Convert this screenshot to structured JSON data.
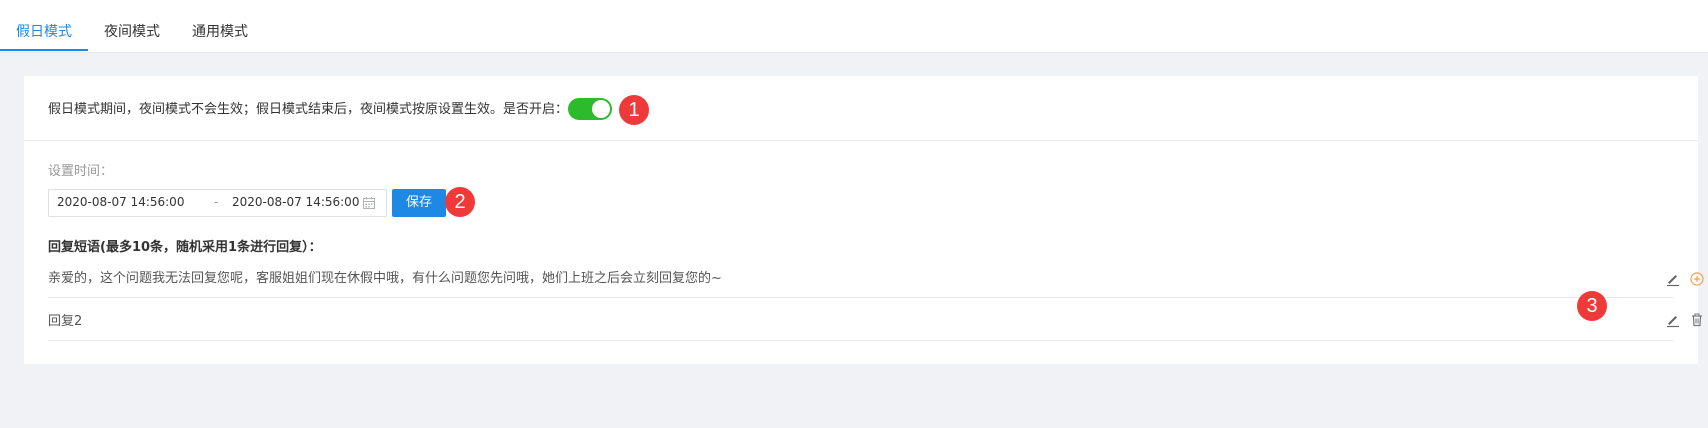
{
  "tabs": [
    {
      "label": "假日模式",
      "active": true
    },
    {
      "label": "夜间模式",
      "active": false
    },
    {
      "label": "通用模式",
      "active": false
    }
  ],
  "holiday": {
    "description": "假日模式期间，夜间模式不会生效；假日模式结束后，夜间模式按原设置生效。是否开启：",
    "enabled": true,
    "time_label": "设置时间：",
    "start_time": "2020-08-07 14:56:00",
    "separator": "-",
    "end_time": "2020-08-07 14:56:00",
    "save_label": "保存",
    "reply_title": "回复短语(最多10条，随机采用1条进行回复）：",
    "replies": [
      {
        "text": "亲爱的，这个问题我无法回复您呢，客服姐姐们现在休假中哦，有什么问题您先问哦，她们上班之后会立刻回复您的~",
        "actions": [
          "edit-icon",
          "add-icon"
        ]
      },
      {
        "text": "回复2",
        "actions": [
          "edit-icon",
          "delete-icon"
        ]
      }
    ]
  },
  "markers": [
    "1",
    "2",
    "3"
  ],
  "colors": {
    "accent": "#1e88e5",
    "switch_on": "#2dbb2d",
    "marker": "#f03a3a",
    "add_icon": "#f5a04a"
  }
}
